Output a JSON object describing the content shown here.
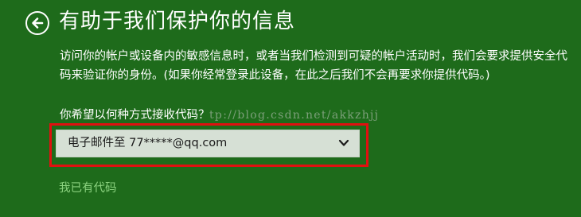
{
  "header": {
    "back_icon": "back-arrow-circle-icon",
    "title": "有助于我们保护你的信息"
  },
  "description": "访问你的帐户或设备内的敏感信息时，或者当我们检测到可疑的帐户活动时，我们会要求提供安全代码来验证你的身份。(如果你经常登录此设备，在此之后我们不会再要求你提供代码。)",
  "question_label": "你希望以何种方式接收代码？",
  "watermark": "tp://blog.csdn.net/akkzhjj",
  "method_select": {
    "selected": "电子邮件至 77*****@qq.com",
    "icon": "chevron-down-icon"
  },
  "have_code_link": "我已有代码",
  "colors": {
    "background": "#1e6b1b",
    "select_background": "#d6e0d5",
    "highlight_border": "#e01010",
    "link": "#8bd27f"
  }
}
